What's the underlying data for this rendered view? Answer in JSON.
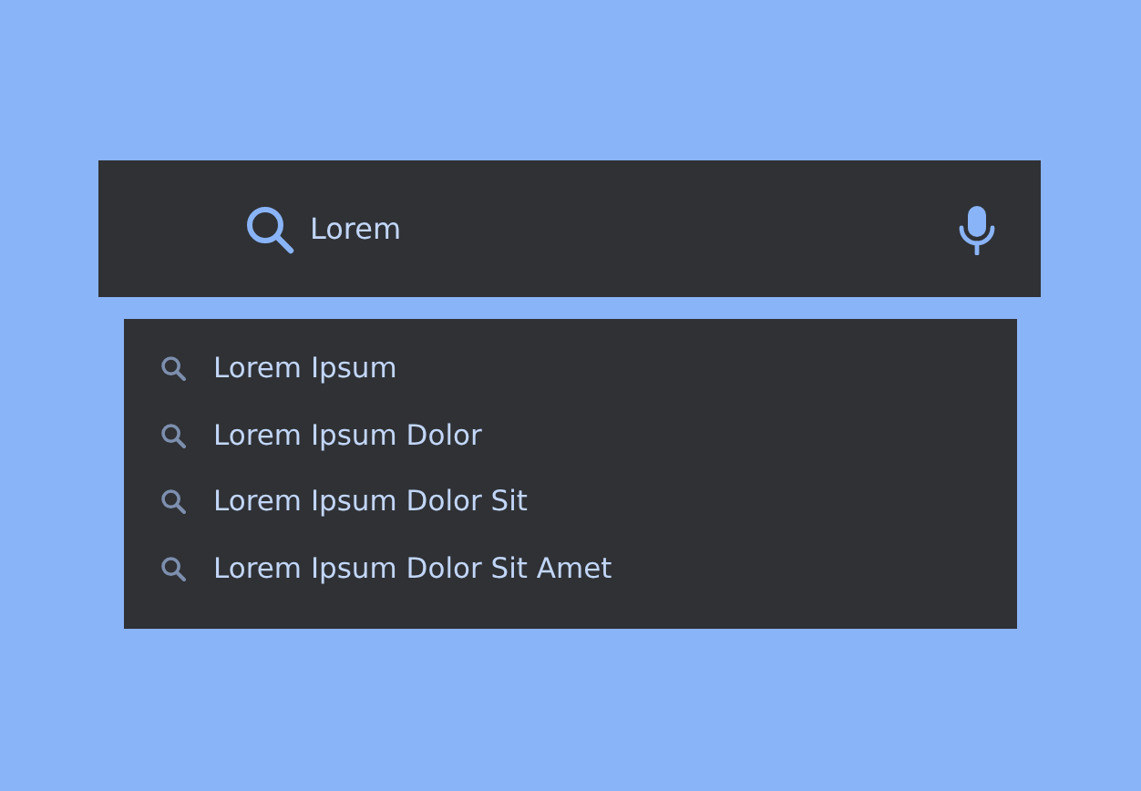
{
  "search": {
    "value": "Lorem"
  },
  "suggestions": [
    "Lorem Ipsum",
    "Lorem Ipsum Dolor",
    "Lorem Ipsum Dolor Sit",
    "Lorem Ipsum Dolor Sit Amet"
  ]
}
